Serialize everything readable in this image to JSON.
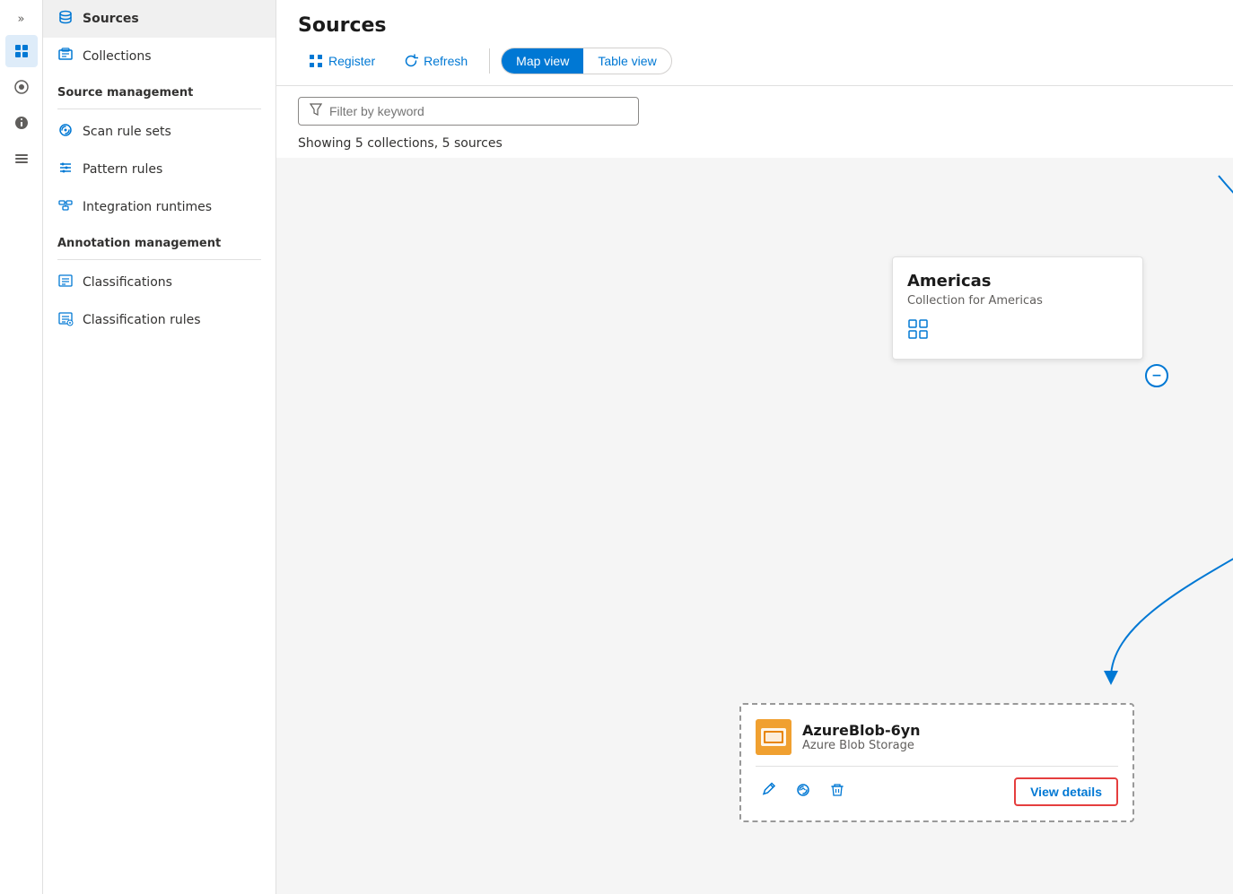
{
  "iconRail": {
    "chevrons": "»",
    "items": [
      {
        "id": "home",
        "icon": "⊞",
        "active": false
      },
      {
        "id": "data-map",
        "icon": "🗺",
        "active": true
      },
      {
        "id": "insights",
        "icon": "◎",
        "active": false
      },
      {
        "id": "catalog",
        "icon": "🔧",
        "active": false
      }
    ]
  },
  "sidebar": {
    "sources_label": "Sources",
    "collections_label": "Collections",
    "source_management_label": "Source management",
    "scan_rule_sets_label": "Scan rule sets",
    "pattern_rules_label": "Pattern rules",
    "integration_runtimes_label": "Integration runtimes",
    "annotation_management_label": "Annotation management",
    "classifications_label": "Classifications",
    "classification_rules_label": "Classification rules"
  },
  "main": {
    "title": "Sources",
    "toolbar": {
      "register_label": "Register",
      "refresh_label": "Refresh",
      "map_view_label": "Map view",
      "table_view_label": "Table view"
    },
    "filter": {
      "placeholder": "Filter by keyword"
    },
    "showing_text": "Showing 5 collections, 5 sources"
  },
  "americas_card": {
    "title": "Americas",
    "subtitle": "Collection for Americas"
  },
  "blob_card": {
    "name": "AzureBlob-6yn",
    "type": "Azure Blob Storage",
    "view_details_label": "View details"
  }
}
